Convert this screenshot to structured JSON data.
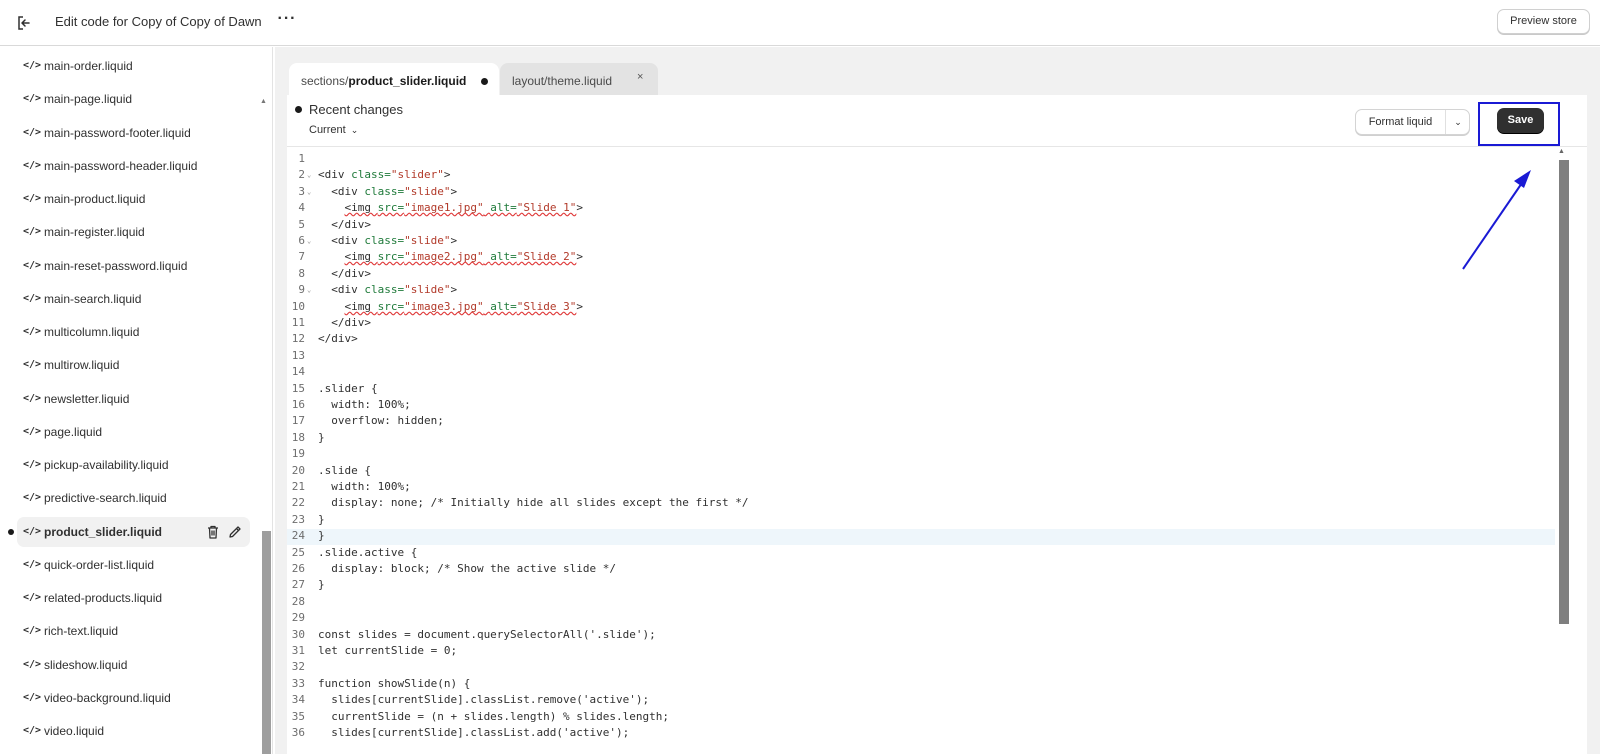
{
  "header": {
    "title": "Edit code for Copy of Copy of Dawn",
    "more_label": "···",
    "preview_label": "Preview store"
  },
  "sidebar": {
    "files": [
      {
        "name": "main-order.liquid"
      },
      {
        "name": "main-page.liquid"
      },
      {
        "name": "main-password-footer.liquid"
      },
      {
        "name": "main-password-header.liquid"
      },
      {
        "name": "main-product.liquid"
      },
      {
        "name": "main-register.liquid"
      },
      {
        "name": "main-reset-password.liquid"
      },
      {
        "name": "main-search.liquid"
      },
      {
        "name": "multicolumn.liquid"
      },
      {
        "name": "multirow.liquid"
      },
      {
        "name": "newsletter.liquid"
      },
      {
        "name": "page.liquid"
      },
      {
        "name": "pickup-availability.liquid"
      },
      {
        "name": "predictive-search.liquid"
      },
      {
        "name": "product_slider.liquid",
        "active": true,
        "unsaved": true
      },
      {
        "name": "quick-order-list.liquid"
      },
      {
        "name": "related-products.liquid"
      },
      {
        "name": "rich-text.liquid"
      },
      {
        "name": "slideshow.liquid"
      },
      {
        "name": "video-background.liquid"
      },
      {
        "name": "video.liquid"
      }
    ],
    "code_icon": "</>"
  },
  "tabs": [
    {
      "folder": "sections/",
      "file": "product_slider.liquid",
      "unsaved": true,
      "active": true
    },
    {
      "label": "layout/theme.liquid",
      "close": "×"
    }
  ],
  "editor": {
    "recent_changes_label": "Recent changes",
    "version_label": "Current",
    "format_label": "Format liquid",
    "save_label": "Save",
    "current_line": 24,
    "lines": [
      "",
      "<div class=\"slider\">",
      "  <div class=\"slide\">",
      "    <img src=\"image1.jpg\" alt=\"Slide 1\">",
      "  </div>",
      "  <div class=\"slide\">",
      "    <img src=\"image2.jpg\" alt=\"Slide 2\">",
      "  </div>",
      "  <div class=\"slide\">",
      "    <img src=\"image3.jpg\" alt=\"Slide 3\">",
      "  </div>",
      "</div>",
      "",
      "",
      ".slider {",
      "  width: 100%;",
      "  overflow: hidden;",
      "}",
      "",
      ".slide {",
      "  width: 100%;",
      "  display: none; /* Initially hide all slides except the first */",
      "}",
      "}",
      ".slide.active {",
      "  display: block; /* Show the active slide */",
      "}",
      "",
      "",
      "const slides = document.querySelectorAll('.slide');",
      "let currentSlide = 0;",
      "",
      "function showSlide(n) {",
      "  slides[currentSlide].classList.remove('active');",
      "  currentSlide = (n + slides.length) % slides.length;",
      "  slides[currentSlide].classList.add('active');"
    ],
    "fold_lines": [
      2,
      3,
      6,
      9
    ]
  },
  "colors": {
    "accent_annotation": "#1a1ad4",
    "save_button": "#303030",
    "current_line": "#eef6fb"
  }
}
